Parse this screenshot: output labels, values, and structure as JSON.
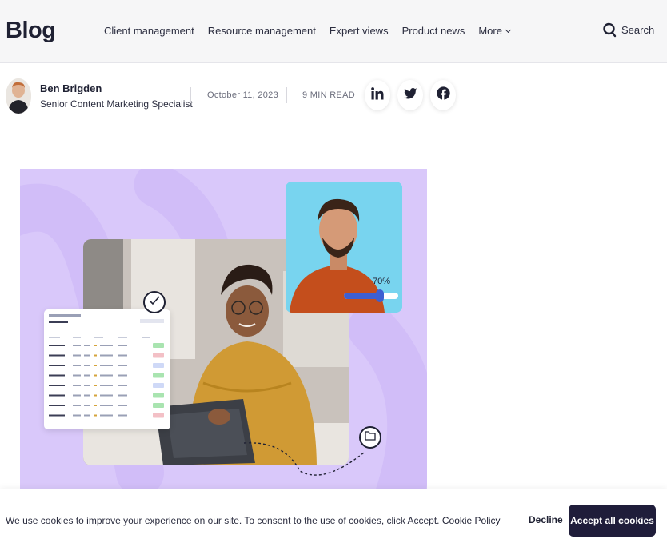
{
  "header": {
    "logo": "Blog",
    "nav": [
      "Client management",
      "Resource management",
      "Expert views",
      "Product news"
    ],
    "more_label": "More",
    "search_label": "Search"
  },
  "author": {
    "name": "Ben Brigden",
    "role": "Senior Content Marketing Specialist",
    "date": "October 11, 2023",
    "read_time": "9 MIN READ",
    "social": [
      "linkedin-icon",
      "twitter-icon",
      "facebook-icon"
    ]
  },
  "hero": {
    "slider_percent_label": "70%",
    "slider_value": 0.7
  },
  "cookie": {
    "text": "We use cookies to improve your experience on our site. To consent to the use of cookies, click Accept.",
    "policy_link": "Cookie Policy",
    "decline_label": "Decline",
    "accept_label": "Accept all cookies"
  },
  "colors": {
    "brand_dark": "#1f1d3a",
    "hero_bg": "#d9c8fa",
    "slider_accent": "#3d5fd1"
  }
}
